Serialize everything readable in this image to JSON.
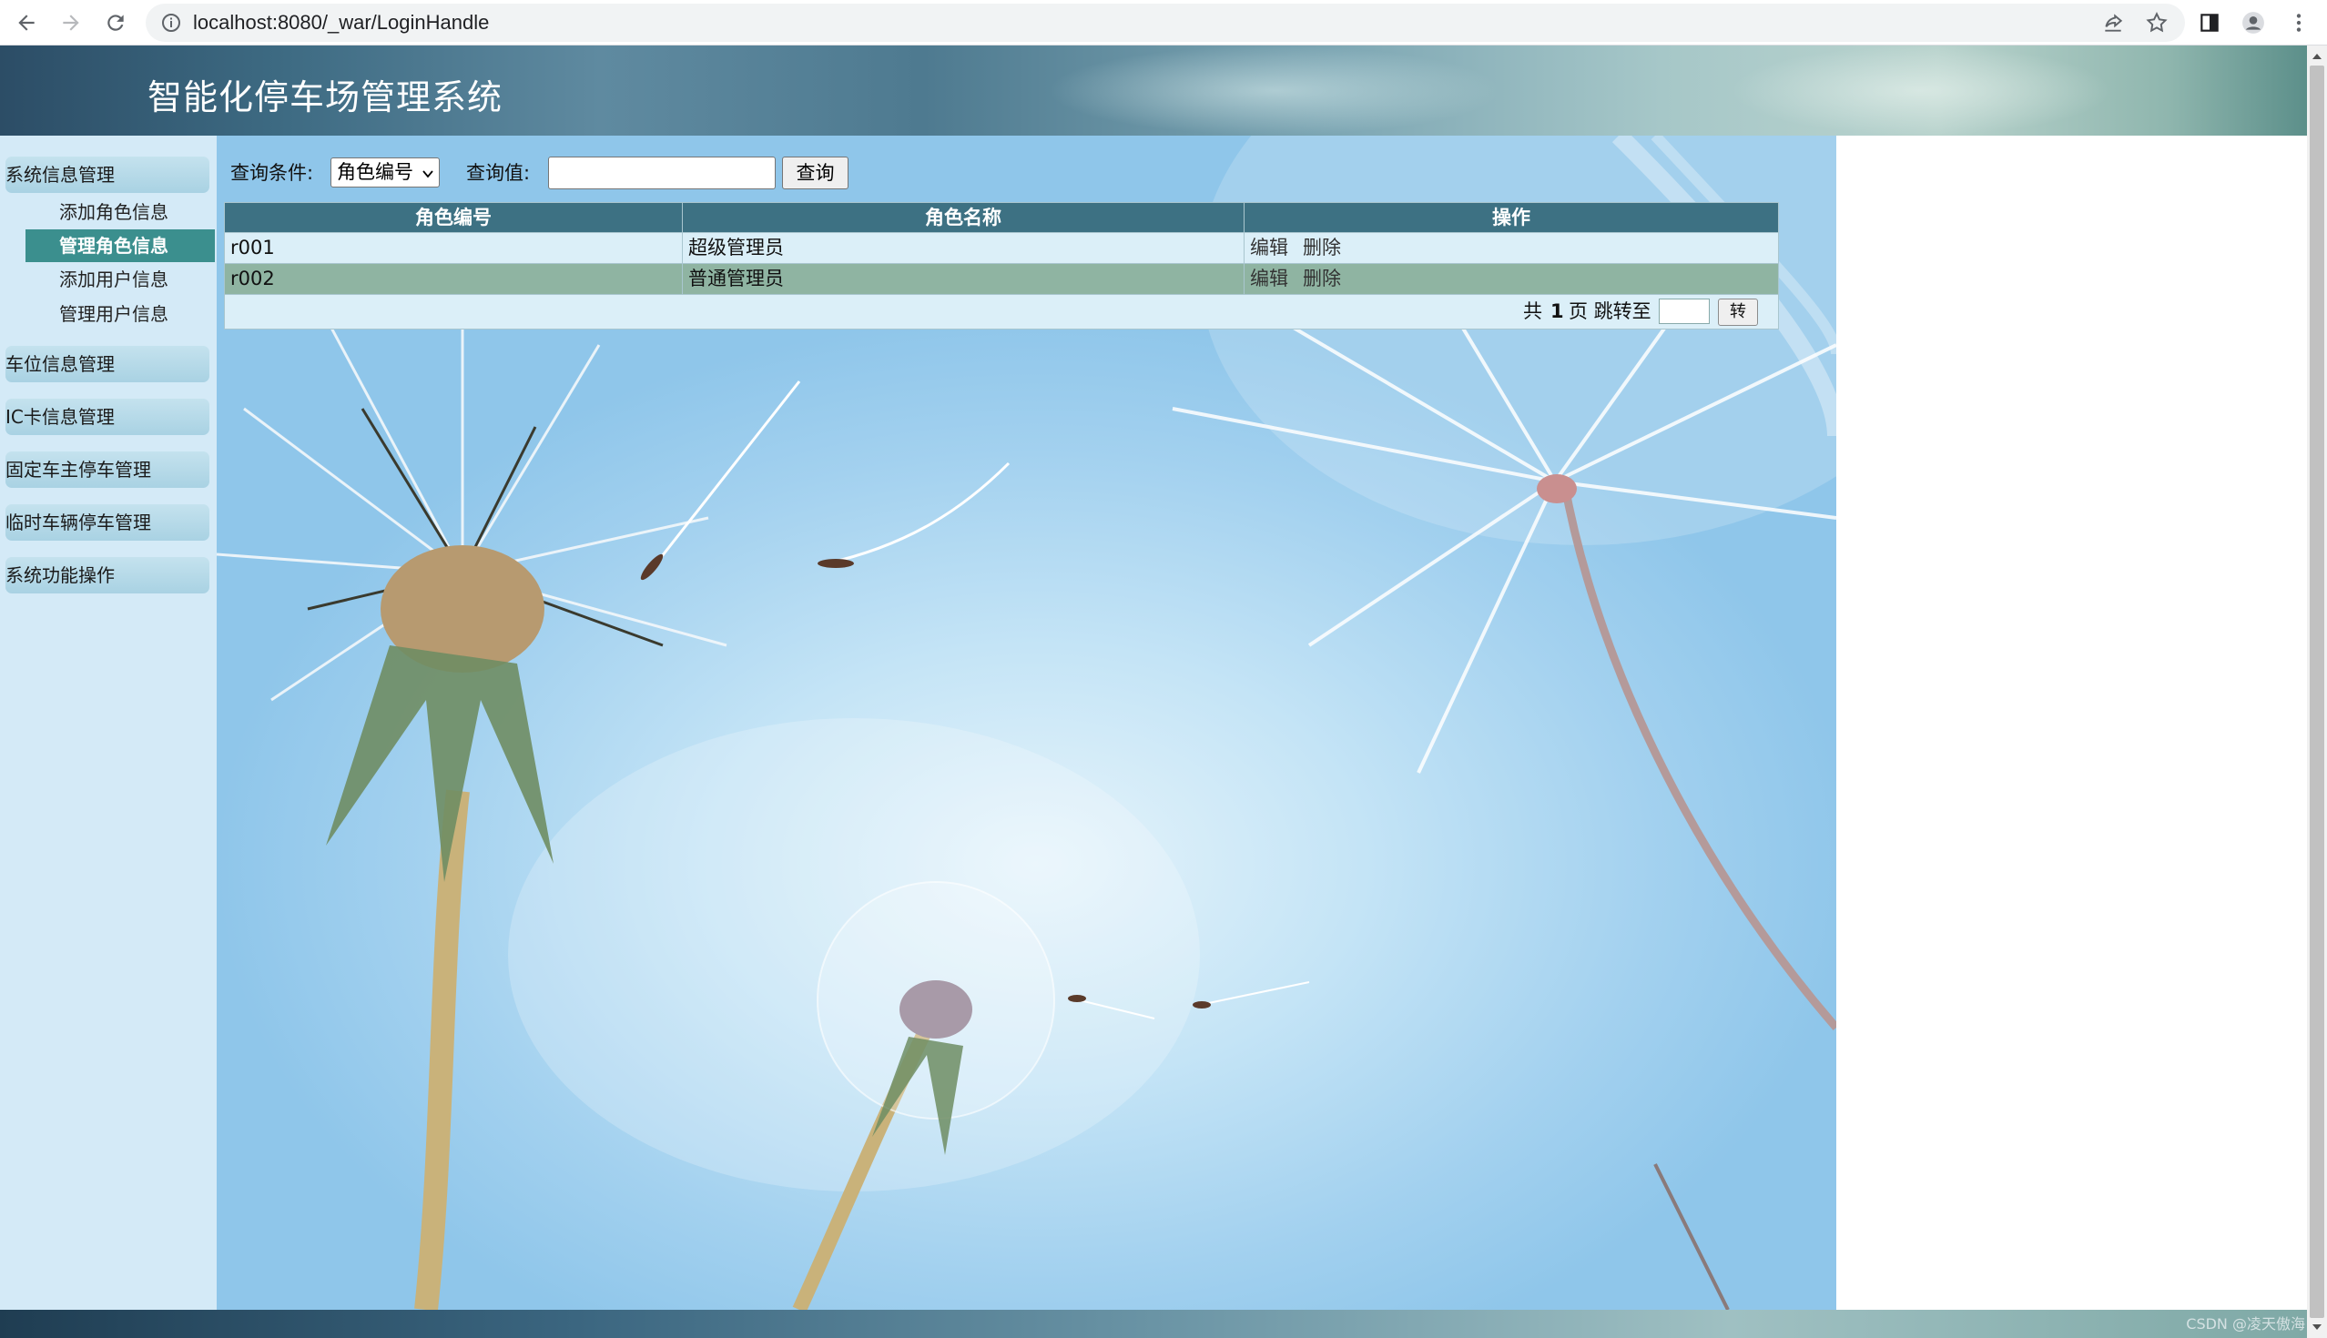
{
  "browser": {
    "url": "localhost:8080/_war/LoginHandle"
  },
  "header": {
    "title": "智能化停车场管理系统"
  },
  "sidebar": {
    "groups": [
      {
        "label": "系统信息管理"
      },
      {
        "label": "车位信息管理"
      },
      {
        "label": "IC卡信息管理"
      },
      {
        "label": "固定车主停车管理"
      },
      {
        "label": "临时车辆停车管理"
      },
      {
        "label": "系统功能操作"
      }
    ],
    "sub_items": [
      {
        "label": "添加角色信息"
      },
      {
        "label": "管理角色信息"
      },
      {
        "label": "添加用户信息"
      },
      {
        "label": "管理用户信息"
      }
    ]
  },
  "query": {
    "condition_label": "查询条件:",
    "condition_value": "角色编号",
    "value_label": "查询值:",
    "value_input": "",
    "button_label": "查询"
  },
  "table": {
    "headers": [
      "角色编号",
      "角色名称",
      "操作"
    ],
    "rows": [
      {
        "id": "r001",
        "name": "超级管理员",
        "edit": "编辑",
        "delete": "删除"
      },
      {
        "id": "r002",
        "name": "普通管理员",
        "edit": "编辑",
        "delete": "删除"
      }
    ]
  },
  "pager": {
    "prefix": "共",
    "total_pages": "1",
    "suffix": "页 跳转至",
    "jump_value": "",
    "button_label": "转"
  },
  "footer": {
    "watermark": "CSDN @凌天傲海"
  },
  "colors": {
    "table_header": "#3d7183",
    "row_odd": "#dbeff8",
    "row_even": "#8fb4a2",
    "active_menu": "#3b8f8e",
    "sidebar_bg": "#d4eaf7"
  }
}
